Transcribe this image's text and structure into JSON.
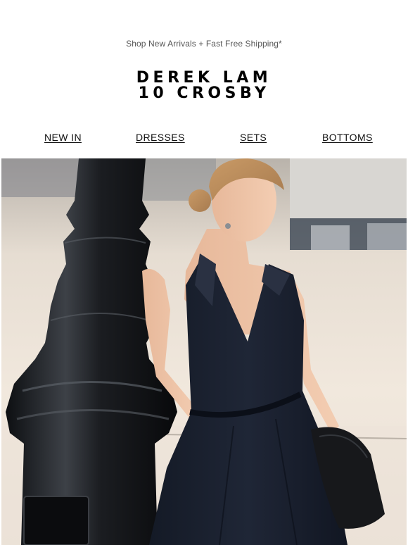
{
  "promo": {
    "text": "Shop New Arrivals + Fast Free Shipping*"
  },
  "brand": {
    "line1": "DEREK LAM",
    "line2": "10 CROSBY"
  },
  "nav": {
    "items": [
      "NEW IN",
      "DRESSES",
      "SETS",
      "BOTTOMS"
    ]
  },
  "hero": {
    "subject": "model-in-navy-halter-dress-by-lamppost"
  }
}
